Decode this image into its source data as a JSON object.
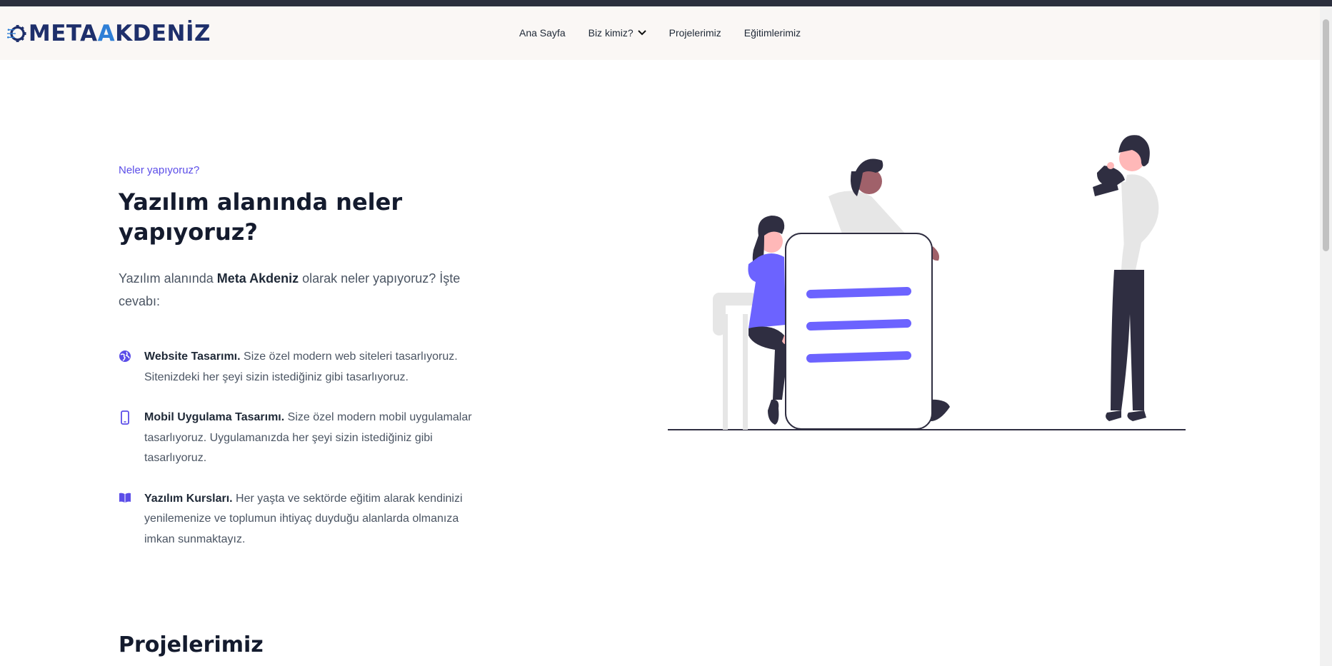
{
  "brand": {
    "name_part1": "META",
    "name_accent": "A",
    "name_part2": "KDENİZ",
    "primary_color": "#1e2f6b",
    "accent_color": "#2f7fd6"
  },
  "nav": {
    "items": [
      {
        "label": "Ana Sayfa"
      },
      {
        "label": "Biz kimiz?",
        "icon": "chevron-down-icon"
      },
      {
        "label": "Projelerimiz"
      },
      {
        "label": "Eğitimlerimiz"
      }
    ]
  },
  "hero": {
    "eyebrow": "Neler yapıyoruz?",
    "title": "Yazılım alanında neler yapıyoruz?",
    "lead_before": "Yazılım alanında ",
    "lead_bold": "Meta Akdeniz",
    "lead_after": " olarak neler yapıyoruz? İşte cevabı:"
  },
  "features": [
    {
      "icon": "globe-icon",
      "title": "Website Tasarımı.",
      "text": " Size özel modern web siteleri tasarlıyoruz. Sitenizdeki her şeyi sizin istediğiniz gibi tasarlıyoruz."
    },
    {
      "icon": "mobile-phone-icon",
      "title": "Mobil Uygulama Tasarımı.",
      "text": " Size özel modern mobil uygulamalar tasarlıyoruz. Uygulamanızda her şeyi sizin istediğiniz gibi tasarlıyoruz."
    },
    {
      "icon": "book-icon",
      "title": "Yazılım Kursları.",
      "text": " Her yaşta ve sektörde eğitim alarak kendinizi yenilemenize ve toplumun ihtiyaç duyduğu alanlarda olmanıza imkan sunmaktayız."
    }
  ],
  "sections": {
    "projects_title": "Projelerimiz"
  },
  "colors": {
    "accent": "#5b4de8",
    "illustration_purple": "#6c63ff",
    "dark": "#2f2e41"
  }
}
